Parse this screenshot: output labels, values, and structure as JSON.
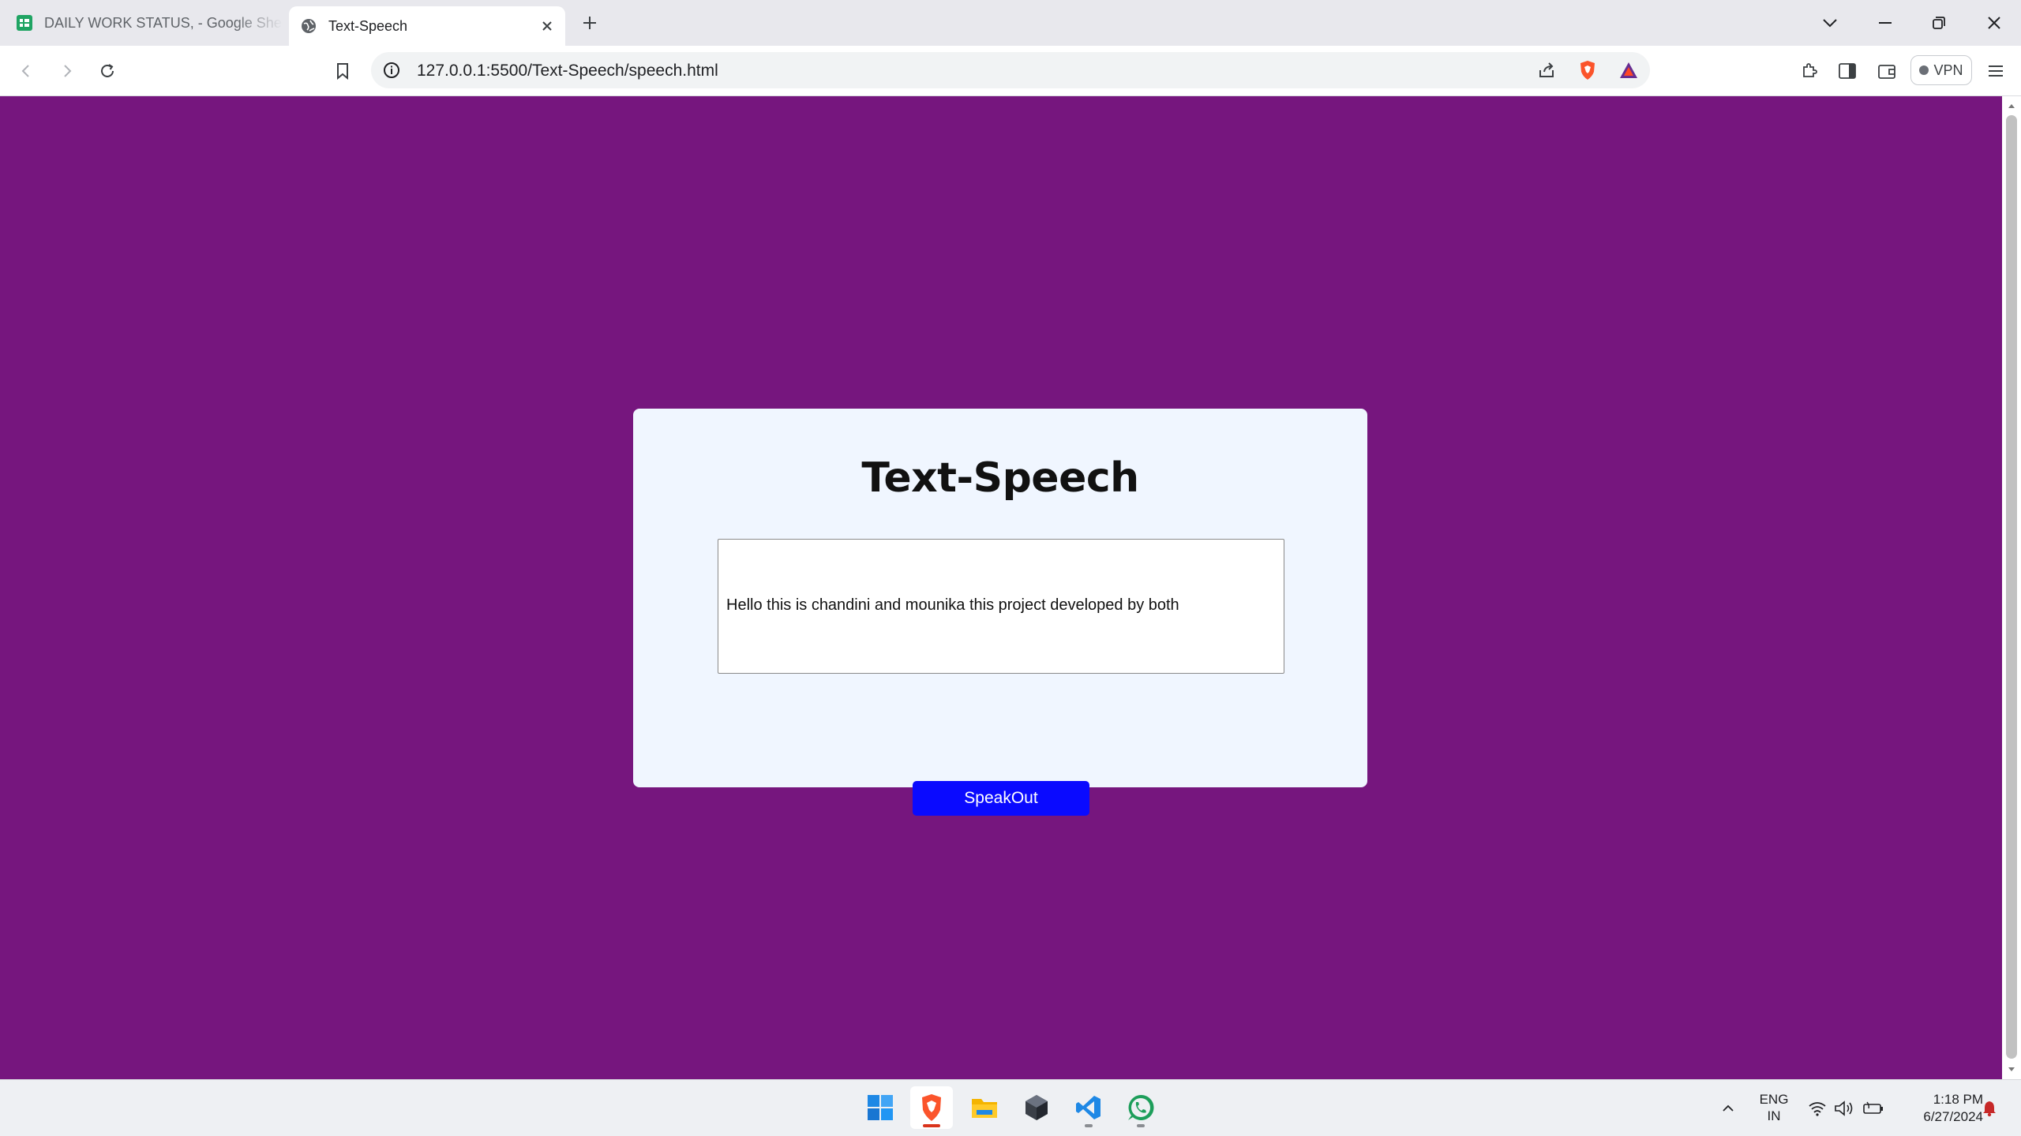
{
  "browser": {
    "tabs": [
      {
        "title": "DAILY WORK STATUS, - Google Sheets",
        "favicon": "google-sheets-icon",
        "active": false
      },
      {
        "title": "Text-Speech",
        "favicon": "globe-icon",
        "active": true
      }
    ],
    "address_bar": {
      "url": "127.0.0.1:5500/Text-Speech/speech.html"
    },
    "vpn_label": "VPN"
  },
  "page": {
    "background_color": "#76167e",
    "card_color": "#f0f6ff",
    "heading": "Text-Speech",
    "textarea_value": "Hello this is chandini and mounika this project developed by both",
    "speak_button_label": "SpeakOut",
    "button_color": "#0a0aff"
  },
  "taskbar": {
    "apps": [
      "windows-start-icon",
      "brave-browser-icon",
      "file-explorer-icon",
      "unity-icon",
      "vs-code-icon",
      "whatsapp-icon"
    ],
    "language": {
      "line1": "ENG",
      "line2": "IN"
    },
    "time": "1:18 PM",
    "date": "6/27/2024"
  }
}
